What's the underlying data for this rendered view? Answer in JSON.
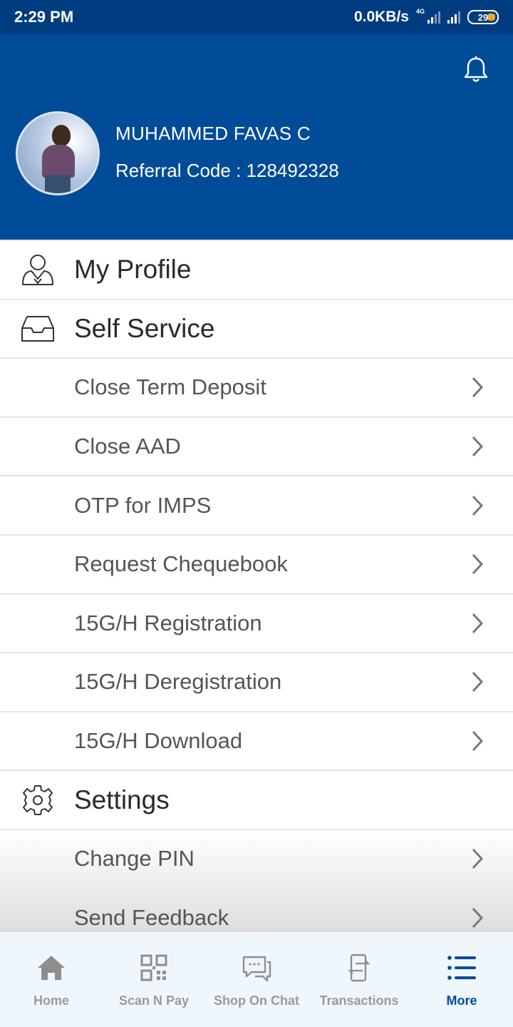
{
  "status_bar": {
    "time": "2:29 PM",
    "network_speed": "0.0KB/s",
    "network_type": "4G",
    "battery": "29"
  },
  "header": {
    "user_name": "MUHAMMED FAVAS C",
    "referral_code": "Referral Code : 128492328",
    "accent_color": "#004c99"
  },
  "menu": {
    "my_profile": "My Profile",
    "self_service": "Self Service",
    "self_service_items": [
      "Close Term Deposit",
      "Close AAD",
      "OTP for IMPS",
      "Request Chequebook",
      "15G/H Registration",
      "15G/H Deregistration",
      "15G/H Download"
    ],
    "settings": "Settings",
    "settings_items": [
      "Change PIN",
      "Send Feedback"
    ]
  },
  "bottom_nav": {
    "items": [
      {
        "label": "Home",
        "icon": "home-icon"
      },
      {
        "label": "Scan N Pay",
        "icon": "qr-code-icon"
      },
      {
        "label": "Shop On Chat",
        "icon": "chat-icon"
      },
      {
        "label": "Transactions",
        "icon": "transactions-icon"
      },
      {
        "label": "More",
        "icon": "menu-icon"
      }
    ],
    "active": "More"
  }
}
